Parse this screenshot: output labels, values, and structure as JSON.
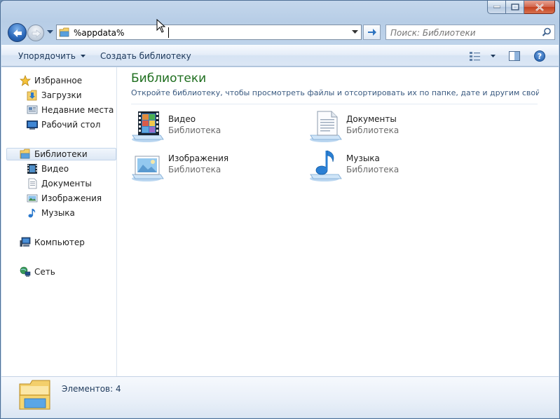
{
  "window": {
    "caption_buttons": [
      {
        "name": "minimize",
        "glyph": "–"
      },
      {
        "name": "maximize",
        "glyph": "□"
      },
      {
        "name": "close",
        "glyph": "✕"
      }
    ]
  },
  "address_bar": {
    "value": "%appdata%",
    "folder_icon": "library-folder-icon"
  },
  "search": {
    "placeholder": "Поиск: Библиотеки",
    "icon": "search-icon"
  },
  "toolbar": {
    "organize_label": "Упорядочить",
    "new_library_label": "Создать библиотеку",
    "help_glyph": "?"
  },
  "sidebar": {
    "favorites": {
      "label": "Избранное",
      "items": [
        {
          "label": "Загрузки",
          "icon": "downloads-icon"
        },
        {
          "label": "Недавние места",
          "icon": "recent-places-icon"
        },
        {
          "label": "Рабочий стол",
          "icon": "desktop-icon"
        }
      ]
    },
    "libraries": {
      "label": "Библиотеки",
      "items": [
        {
          "label": "Видео",
          "icon": "video-icon"
        },
        {
          "label": "Документы",
          "icon": "documents-icon"
        },
        {
          "label": "Изображения",
          "icon": "pictures-icon"
        },
        {
          "label": "Музыка",
          "icon": "music-icon"
        }
      ]
    },
    "computer": {
      "label": "Компьютер"
    },
    "network": {
      "label": "Сеть"
    }
  },
  "main": {
    "title": "Библиотеки",
    "description": "Откройте библиотеку, чтобы просмотреть файлы и отсортировать их по папке, дате и другим свойств...",
    "libraries": [
      {
        "name": "Видео",
        "type": "Библиотека",
        "icon": "video-library-icon"
      },
      {
        "name": "Документы",
        "type": "Библиотека",
        "icon": "documents-library-icon"
      },
      {
        "name": "Изображения",
        "type": "Библиотека",
        "icon": "pictures-library-icon"
      },
      {
        "name": "Музыка",
        "type": "Библиотека",
        "icon": "music-library-icon"
      }
    ]
  },
  "details": {
    "count_text": "Элементов: 4"
  },
  "colors": {
    "title_green": "#1e6e1e",
    "description_blue": "#3a5a80",
    "window_frame": "#b7cde6"
  }
}
